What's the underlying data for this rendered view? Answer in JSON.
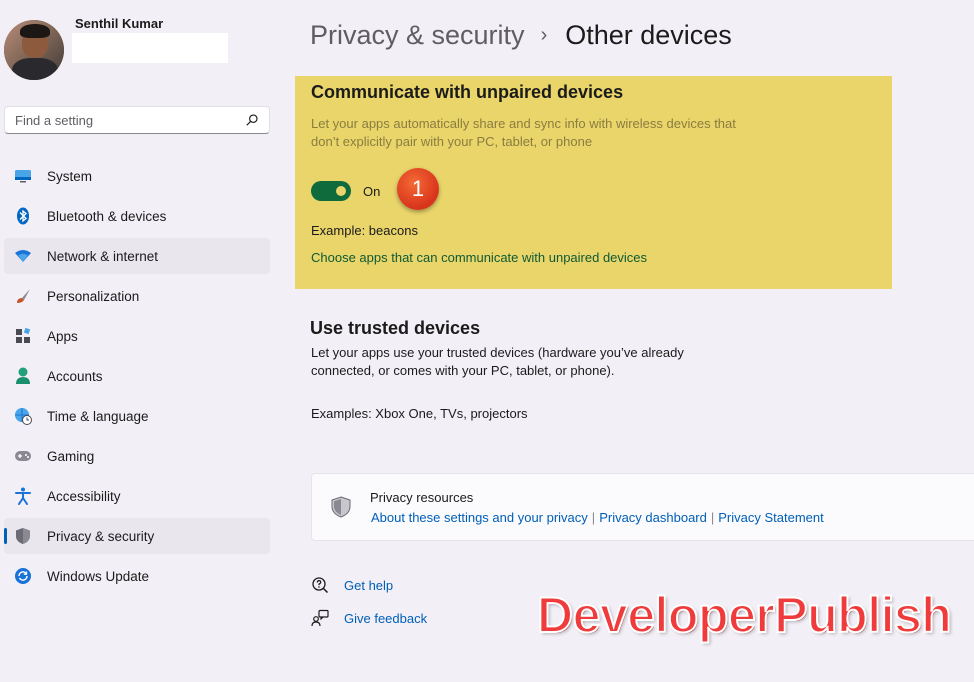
{
  "profile": {
    "name": "Senthil Kumar",
    "email": ""
  },
  "search": {
    "placeholder": "Find a setting",
    "icon": "search-icon"
  },
  "sidebar": {
    "items": [
      {
        "label": "System",
        "icon": "monitor-icon",
        "color": "#0067c0"
      },
      {
        "label": "Bluetooth & devices",
        "icon": "bluetooth-icon",
        "color": "#0067c0"
      },
      {
        "label": "Network & internet",
        "icon": "wifi-icon",
        "color": "#1a73d9"
      },
      {
        "label": "Personalization",
        "icon": "brush-icon",
        "color": "#c2552b"
      },
      {
        "label": "Apps",
        "icon": "apps-icon",
        "color": "#4a4a55"
      },
      {
        "label": "Accounts",
        "icon": "person-icon",
        "color": "#22a07a"
      },
      {
        "label": "Time & language",
        "icon": "globe-clock-icon",
        "color": "#1a73d9"
      },
      {
        "label": "Gaming",
        "icon": "gamepad-icon",
        "color": "#6b6b75"
      },
      {
        "label": "Accessibility",
        "icon": "accessibility-icon",
        "color": "#1a73d9"
      },
      {
        "label": "Privacy & security",
        "icon": "shield-icon",
        "color": "#6b6b75"
      },
      {
        "label": "Windows Update",
        "icon": "update-icon",
        "color": "#1a73d9"
      }
    ],
    "selected_index": 9,
    "hover_index": 2
  },
  "breadcrumb": {
    "parent": "Privacy & security",
    "separator": "›",
    "current": "Other devices"
  },
  "unpaired": {
    "title": "Communicate with unpaired devices",
    "description": "Let your apps automatically share and sync info with wireless devices that don’t explicitly pair with your PC, tablet, or phone",
    "toggle_state": "On",
    "toggle_on": true,
    "badge": "1",
    "example": "Example: beacons",
    "link": "Choose apps that can communicate with unpaired devices"
  },
  "trusted": {
    "title": "Use trusted devices",
    "description": "Let your apps use your trusted devices (hardware you’ve already connected, or comes with your PC, tablet, or phone).",
    "example": "Examples: Xbox One, TVs, projectors"
  },
  "resources": {
    "title": "Privacy resources",
    "links": [
      "About these settings and your privacy",
      "Privacy dashboard",
      "Privacy Statement"
    ]
  },
  "footer": {
    "help": "Get help",
    "feedback": "Give feedback"
  },
  "watermark": "DeveloperPublish",
  "colors": {
    "accent": "#005fb8",
    "highlight": "#e9d56a",
    "toggle": "#0f6b3c",
    "badge": "#e23e1f",
    "watermark": "#ef3b3b"
  }
}
